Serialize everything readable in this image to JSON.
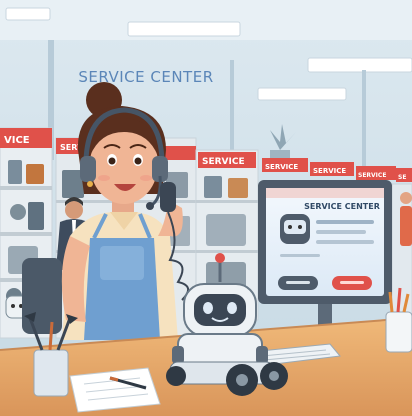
{
  "wall_sign": "SERVICE CENTER",
  "shelf_signs": [
    "VICE",
    "SERVICE",
    "SERVICE",
    "SERVICE",
    "SERVICE",
    "SERVICE",
    "SE"
  ],
  "monitor": {
    "title": "SERVICE CENTER"
  },
  "colors": {
    "wall": "#cfe0ea",
    "accent_red": "#e0514a",
    "apron": "#6f9fd0",
    "desk": "#e7a96a",
    "screen": "#e9f2fb"
  }
}
